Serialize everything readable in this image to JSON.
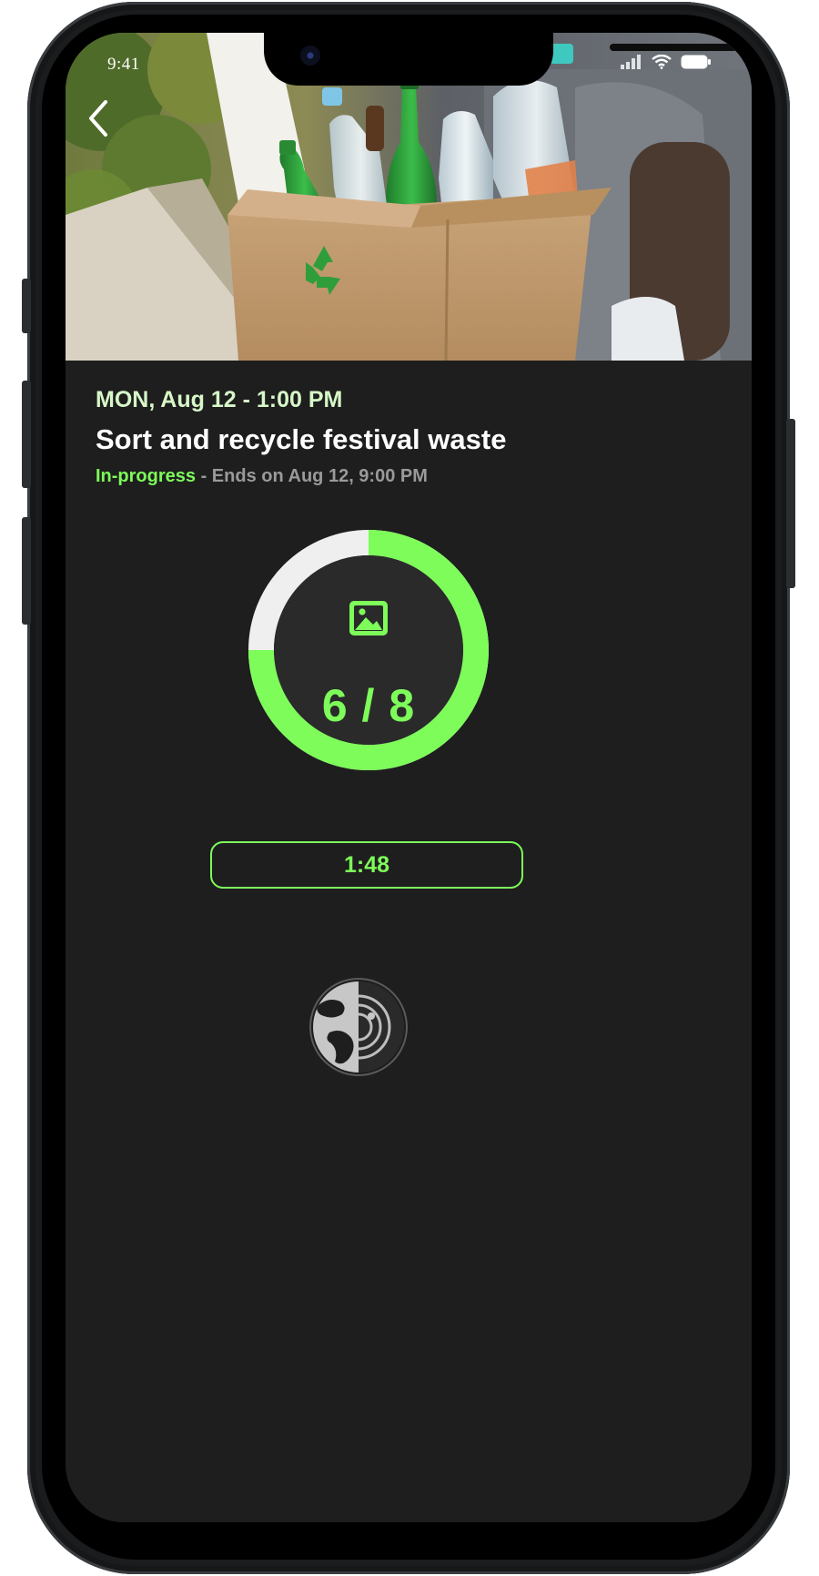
{
  "status_bar": {
    "time": "9:41"
  },
  "event": {
    "date": "MON, Aug 12 - 1:00 PM",
    "title": "Sort and recycle festival waste",
    "status": "In-progress",
    "status_detail": "- Ends on Aug 12, 9:00 PM"
  },
  "progress": {
    "label": "6 / 8",
    "completed": 6,
    "total": 8,
    "icon": "image-icon"
  },
  "timer": {
    "value": "1:48"
  },
  "colors": {
    "accent": "#7dfc5a",
    "date_text": "#d7f7c8",
    "background": "#1e1e1e",
    "ring_track": "#efefef"
  },
  "icons": {
    "back": "chevron-left-icon",
    "signal": "signal-icon",
    "wifi": "wifi-icon",
    "battery": "battery-icon",
    "theme": "theme-toggle-icon"
  }
}
